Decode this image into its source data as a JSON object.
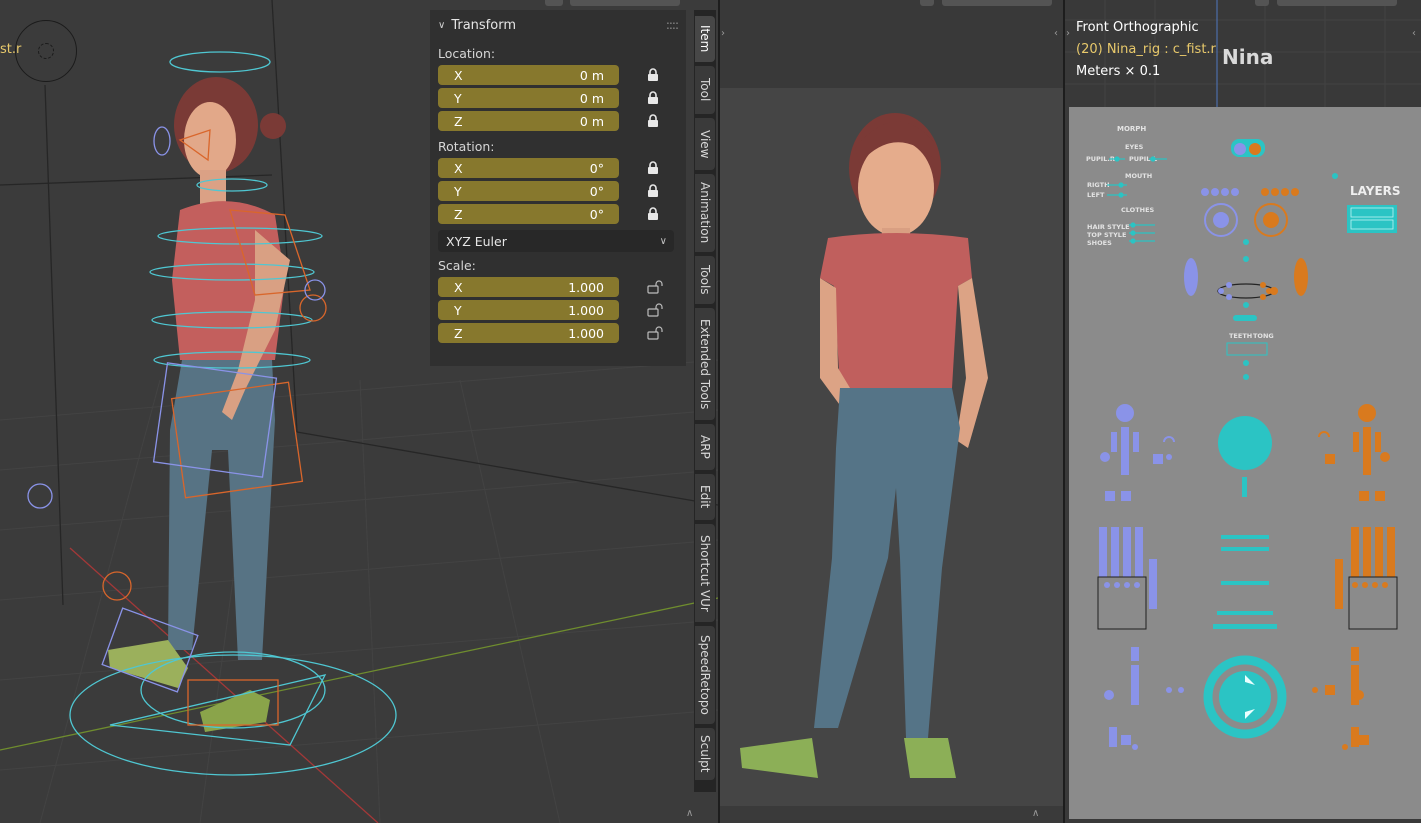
{
  "left_viewport": {
    "object_label": "st.r"
  },
  "npanel": {
    "header": "Transform",
    "location": {
      "label": "Location:",
      "rows": [
        {
          "axis": "X",
          "value": "0 m"
        },
        {
          "axis": "Y",
          "value": "0 m"
        },
        {
          "axis": "Z",
          "value": "0 m"
        }
      ]
    },
    "rotation": {
      "label": "Rotation:",
      "rows": [
        {
          "axis": "X",
          "value": "0°"
        },
        {
          "axis": "Y",
          "value": "0°"
        },
        {
          "axis": "Z",
          "value": "0°"
        }
      ],
      "mode": "XYZ Euler"
    },
    "scale": {
      "label": "Scale:",
      "rows": [
        {
          "axis": "X",
          "value": "1.000"
        },
        {
          "axis": "Y",
          "value": "1.000"
        },
        {
          "axis": "Z",
          "value": "1.000"
        }
      ]
    }
  },
  "tabs": [
    "Item",
    "Tool",
    "View",
    "Animation",
    "Tools",
    "Extended Tools",
    "ARP",
    "Edit",
    "Shortcut VUr",
    "SpeedRetopo",
    "Sculpt"
  ],
  "right_viewport": {
    "view_name": "Front Orthographic",
    "selection": "(20) Nina_rig : c_fist.r",
    "units": "Meters × 0.1",
    "character_name": "Nina"
  },
  "picker": {
    "morph": "MORPH",
    "eyes": "EYES",
    "pupil_r": "PUPIL.R",
    "pupil_l": "PUPIL.L",
    "mouth": "MOUTH",
    "right": "RIGTH",
    "left": "LEFT",
    "clothes": "CLOTHES",
    "hair_style": "HAIR STYLE",
    "top_style": "TOP STYLE",
    "shoes": "SHOES",
    "layers": "LAYERS",
    "teeth": "TEETH",
    "tong": "TONG"
  },
  "colors": {
    "field_bg": "#87782d",
    "selection_text": "#e8c96b",
    "picker_blue": "#8a93e8",
    "picker_orange": "#d97a1e",
    "picker_cyan": "#2bc4c4"
  }
}
